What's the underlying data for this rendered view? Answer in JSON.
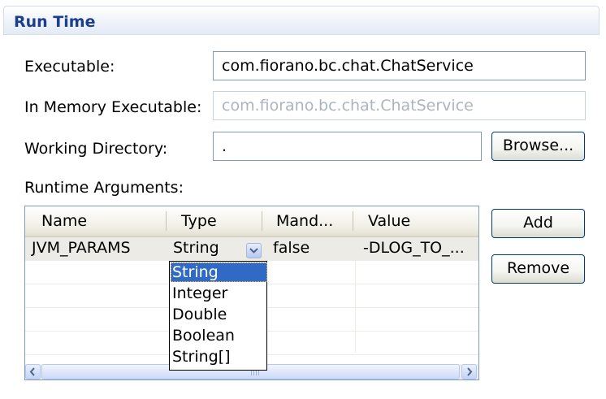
{
  "section": {
    "title": "Run Time"
  },
  "fields": {
    "executable": {
      "label": "Executable:",
      "value": "com.fiorano.bc.chat.ChatService"
    },
    "in_memory_executable": {
      "label": "In Memory Executable:",
      "value": "com.fiorano.bc.chat.ChatService",
      "disabled": true
    },
    "working_directory": {
      "label": "Working Directory:",
      "value": "."
    }
  },
  "buttons": {
    "browse": "Browse...",
    "add": "Add",
    "remove": "Remove"
  },
  "runtime_arguments": {
    "label": "Runtime Arguments:",
    "columns": [
      "Name",
      "Type",
      "Mand...",
      "Value"
    ],
    "rows": [
      {
        "name": "JVM_PARAMS",
        "type": "String",
        "mandatory": "false",
        "value": "-DLOG_TO_..."
      }
    ],
    "type_options": [
      "String",
      "Integer",
      "Double",
      "Boolean",
      "String[]"
    ],
    "selected_type": "String"
  },
  "icons": {
    "combo_arrow": "chevron-down-icon",
    "scroll_left": "arrow-left-icon",
    "scroll_right": "arrow-right-icon"
  },
  "colors": {
    "title": "#1b3e8e",
    "selection": "#316ac5",
    "border": "#7f9db9"
  }
}
